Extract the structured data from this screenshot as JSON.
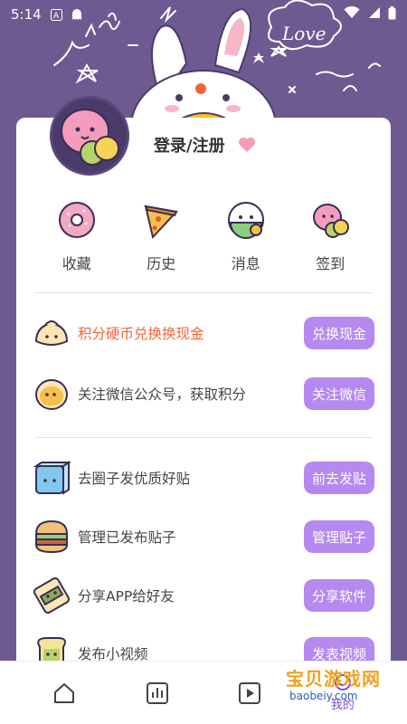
{
  "status_bar": {
    "time": "5:14",
    "icons": [
      "sim-a-icon",
      "notification-ghost-icon",
      "wifi-icon",
      "signal-icon",
      "battery-icon"
    ]
  },
  "profile": {
    "login_label": "登录/注册"
  },
  "quick_actions": [
    {
      "label": "收藏",
      "icon": "donut-favorites-icon"
    },
    {
      "label": "历史",
      "icon": "pizza-history-icon"
    },
    {
      "label": "消息",
      "icon": "onigiri-messages-icon"
    },
    {
      "label": "签到",
      "icon": "macaron-checkin-icon"
    }
  ],
  "tasks": [
    {
      "text": "积分硬币兑换换现金",
      "button": "兑换现金",
      "icon": "dumpling-coin-icon",
      "highlight": true
    },
    {
      "text": "关注微信公众号，获取积分",
      "button": "关注微信",
      "icon": "egg-wechat-icon",
      "highlight": false
    },
    {
      "text": "去圈子发优质好贴",
      "button": "前去发贴",
      "icon": "ice-cube-post-icon",
      "highlight": false
    },
    {
      "text": "管理已发布贴子",
      "button": "管理贴子",
      "icon": "burger-manage-icon",
      "highlight": false
    },
    {
      "text": "分享APP给好友",
      "button": "分享软件",
      "icon": "sushi-share-icon",
      "highlight": false
    },
    {
      "text": "发布小视频",
      "button": "发表视频",
      "icon": "toast-video-icon",
      "highlight": false
    }
  ],
  "tab_bar": [
    {
      "name": "home",
      "icon": "home-icon",
      "label": ""
    },
    {
      "name": "stats",
      "icon": "chart-icon",
      "label": ""
    },
    {
      "name": "video",
      "icon": "play-icon",
      "label": ""
    },
    {
      "name": "mine",
      "icon": "profile-icon",
      "label": "我的"
    }
  ],
  "watermark": {
    "title": "宝贝游戏网",
    "url": "baobeiy.com"
  },
  "colors": {
    "background": "#6e5a91",
    "button": "#b589ef",
    "highlight_text": "#f0663a",
    "active_tab": "#7a4fd0"
  }
}
